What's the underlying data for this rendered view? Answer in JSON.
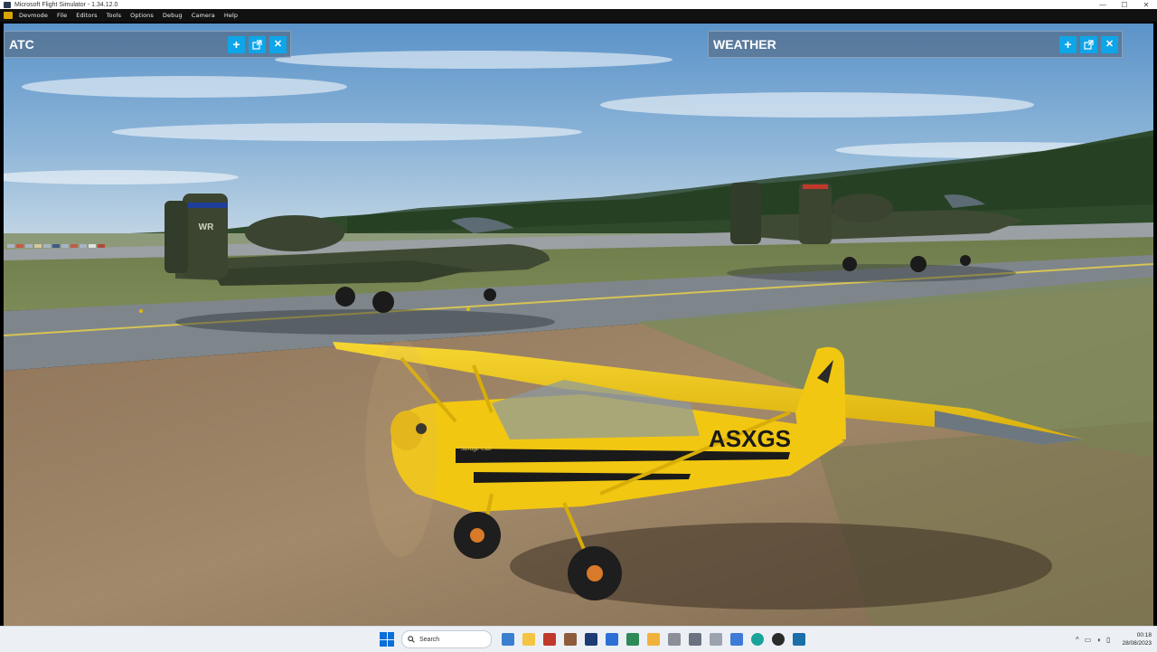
{
  "window": {
    "title": "Microsoft Flight Simulator - 1.34.12.0",
    "controls": [
      "—",
      "☐",
      "✕"
    ]
  },
  "menubar": {
    "items": [
      "Devmode",
      "File",
      "Editors",
      "Tools",
      "Options",
      "Debug",
      "Camera",
      "Help"
    ]
  },
  "panels": {
    "atc": {
      "title": "ATC"
    },
    "weather": {
      "title": "WEATHER"
    },
    "buttons": {
      "add": "+",
      "close": "✕"
    }
  },
  "scene": {
    "cub_registration": "ASXGS",
    "cub_badge": "Savage Cub",
    "jet_tail_code": "WR"
  },
  "taskbar": {
    "search_placeholder": "Search",
    "time": "00:18",
    "date": "28/08/2023",
    "tray_chevron": "^",
    "icons": [
      "windows-start",
      "search",
      "widgets",
      "file-explorer",
      "office",
      "calendar",
      "msfs",
      "store",
      "xbox",
      "files",
      "settings",
      "tools",
      "weather-app",
      "onedrive",
      "edge",
      "chrome",
      "steam"
    ],
    "colors": {
      "accent": "#0a6fd8"
    }
  },
  "colors": {
    "panel_button": "#0ea5e9",
    "cub_yellow": "#f2c712",
    "jet_green": "#3f4a34"
  }
}
